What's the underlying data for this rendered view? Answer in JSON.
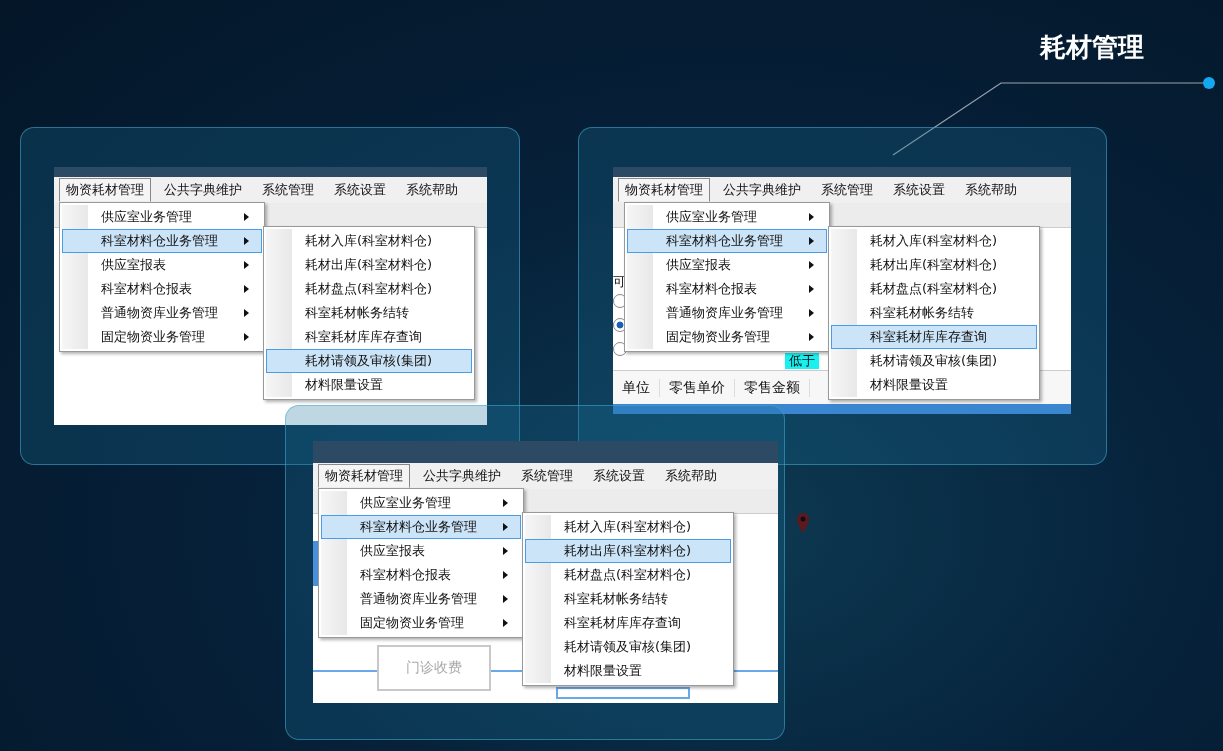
{
  "title": "耗材管理",
  "screens": [
    {
      "menubar": [
        {
          "label": "物资耗材管理",
          "selected": true
        },
        {
          "label": "公共字典维护",
          "selected": false
        },
        {
          "label": "系统管理",
          "selected": false
        },
        {
          "label": "系统设置",
          "selected": false
        },
        {
          "label": "系统帮助",
          "selected": false
        }
      ],
      "menu": [
        {
          "label": "供应室业务管理",
          "selected": false
        },
        {
          "label": "科室材料仓业务管理",
          "selected": true
        },
        {
          "label": "供应室报表",
          "selected": false
        },
        {
          "label": "科室材料仓报表",
          "selected": false
        },
        {
          "label": "普通物资库业务管理",
          "selected": false
        },
        {
          "label": "固定物资业务管理",
          "selected": false
        }
      ],
      "submenu": [
        {
          "label": "耗材入库(科室材料仓)",
          "selected": false
        },
        {
          "label": "耗材出库(科室材料仓)",
          "selected": false
        },
        {
          "label": "耗材盘点(科室材料仓)",
          "selected": false
        },
        {
          "label": "科室耗材帐务结转",
          "selected": false
        },
        {
          "label": "科室耗材库库存查询",
          "selected": false
        },
        {
          "label": "耗材请领及审核(集团)",
          "selected": true
        },
        {
          "label": "材料限量设置",
          "selected": false
        }
      ]
    },
    {
      "menubar": [
        {
          "label": "物资耗材管理",
          "selected": true
        },
        {
          "label": "公共字典维护",
          "selected": false
        },
        {
          "label": "系统管理",
          "selected": false
        },
        {
          "label": "系统设置",
          "selected": false
        },
        {
          "label": "系统帮助",
          "selected": false
        }
      ],
      "menu": [
        {
          "label": "供应室业务管理",
          "selected": false
        },
        {
          "label": "科室材料仓业务管理",
          "selected": true
        },
        {
          "label": "供应室报表",
          "selected": false
        },
        {
          "label": "科室材料仓报表",
          "selected": false
        },
        {
          "label": "普通物资库业务管理",
          "selected": false
        },
        {
          "label": "固定物资业务管理",
          "selected": false
        }
      ],
      "submenu": [
        {
          "label": "耗材入库(科室材料仓)",
          "selected": false
        },
        {
          "label": "耗材出库(科室材料仓)",
          "selected": false
        },
        {
          "label": "耗材盘点(科室材料仓)",
          "selected": false
        },
        {
          "label": "科室耗材帐务结转",
          "selected": false
        },
        {
          "label": "科室耗材库库存查询",
          "selected": true
        },
        {
          "label": "耗材请领及审核(集团)",
          "selected": false
        },
        {
          "label": "材料限量设置",
          "selected": false
        }
      ],
      "form_label": "可",
      "radios": [
        {
          "selected": false
        },
        {
          "selected": true
        },
        {
          "selected": false
        }
      ],
      "highlight_label": "低于",
      "table_headers": [
        "单位",
        "零售单价",
        "零售金额"
      ]
    },
    {
      "menubar": [
        {
          "label": "物资耗材管理",
          "selected": true
        },
        {
          "label": "公共字典维护",
          "selected": false
        },
        {
          "label": "系统管理",
          "selected": false
        },
        {
          "label": "系统设置",
          "selected": false
        },
        {
          "label": "系统帮助",
          "selected": false
        }
      ],
      "menu": [
        {
          "label": "供应室业务管理",
          "selected": false
        },
        {
          "label": "科室材料仓业务管理",
          "selected": true
        },
        {
          "label": "供应室报表",
          "selected": false
        },
        {
          "label": "科室材料仓报表",
          "selected": false
        },
        {
          "label": "普通物资库业务管理",
          "selected": false
        },
        {
          "label": "固定物资业务管理",
          "selected": false
        }
      ],
      "submenu": [
        {
          "label": "耗材入库(科室材料仓)",
          "selected": false
        },
        {
          "label": "耗材出库(科室材料仓)",
          "selected": true
        },
        {
          "label": "耗材盘点(科室材料仓)",
          "selected": false
        },
        {
          "label": "科室耗材帐务结转",
          "selected": false
        },
        {
          "label": "科室耗材库库存查询",
          "selected": false
        },
        {
          "label": "耗材请领及审核(集团)",
          "selected": false
        },
        {
          "label": "材料限量设置",
          "selected": false
        }
      ],
      "button": "门诊收费"
    }
  ]
}
